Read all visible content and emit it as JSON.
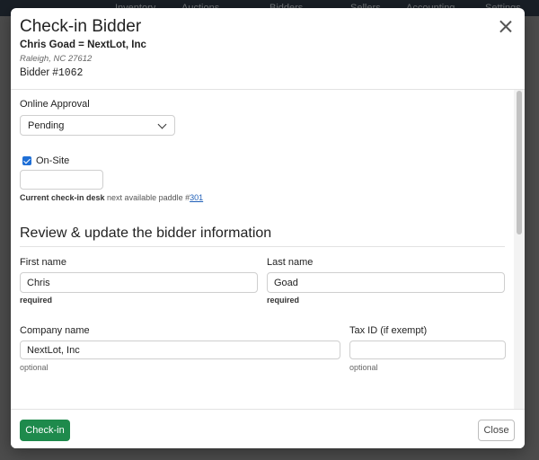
{
  "background": {
    "nav_items": [
      "Inventory",
      "Auctions",
      "Bidders",
      "Sellers",
      "Accounting",
      "Settings"
    ]
  },
  "modal": {
    "title": "Check-in Bidder",
    "bidder_name": "Chris Goad = NextLot, Inc",
    "bidder_location": "Raleigh, NC 27612",
    "bidder_number_label": "Bidder #",
    "bidder_number": "1062"
  },
  "form": {
    "online_approval_label": "Online Approval",
    "online_approval_value": "Pending",
    "onsite_label": "On-Site",
    "onsite_checked": true,
    "paddle_value": "",
    "desk_note_bold": "Current check-in desk",
    "desk_note_text": "next available paddle #",
    "desk_note_link": "301",
    "section_title": "Review & update the bidder information",
    "first_name_label": "First name",
    "first_name_value": "Chris",
    "first_name_hint": "required",
    "last_name_label": "Last name",
    "last_name_value": "Goad",
    "last_name_hint": "required",
    "company_label": "Company name",
    "company_value": "NextLot, Inc",
    "company_hint": "optional",
    "taxid_label": "Tax ID (if exempt)",
    "taxid_value": "",
    "taxid_hint": "optional"
  },
  "footer": {
    "checkin_label": "Check-in",
    "close_label": "Close"
  },
  "colors": {
    "primary_button": "#1e8a4c",
    "checkbox": "#1f6fd6",
    "link": "#1f5fb8"
  }
}
